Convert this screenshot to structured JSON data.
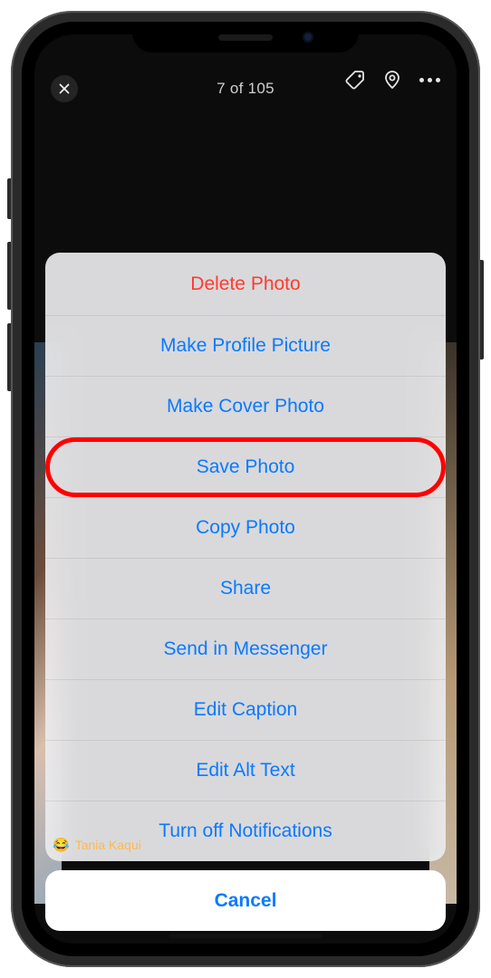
{
  "header": {
    "counter": "7 of 105"
  },
  "actions": {
    "delete": "Delete Photo",
    "profile": "Make Profile Picture",
    "cover": "Make Cover Photo",
    "save": "Save Photo",
    "copy": "Copy Photo",
    "share": "Share",
    "messenger": "Send in Messenger",
    "caption": "Edit Caption",
    "alttext": "Edit Alt Text",
    "notifications": "Turn off Notifications"
  },
  "cancel_label": "Cancel",
  "tag": {
    "emoji": "😂",
    "name": "Tania Kaqui"
  },
  "highlighted_action": "save"
}
